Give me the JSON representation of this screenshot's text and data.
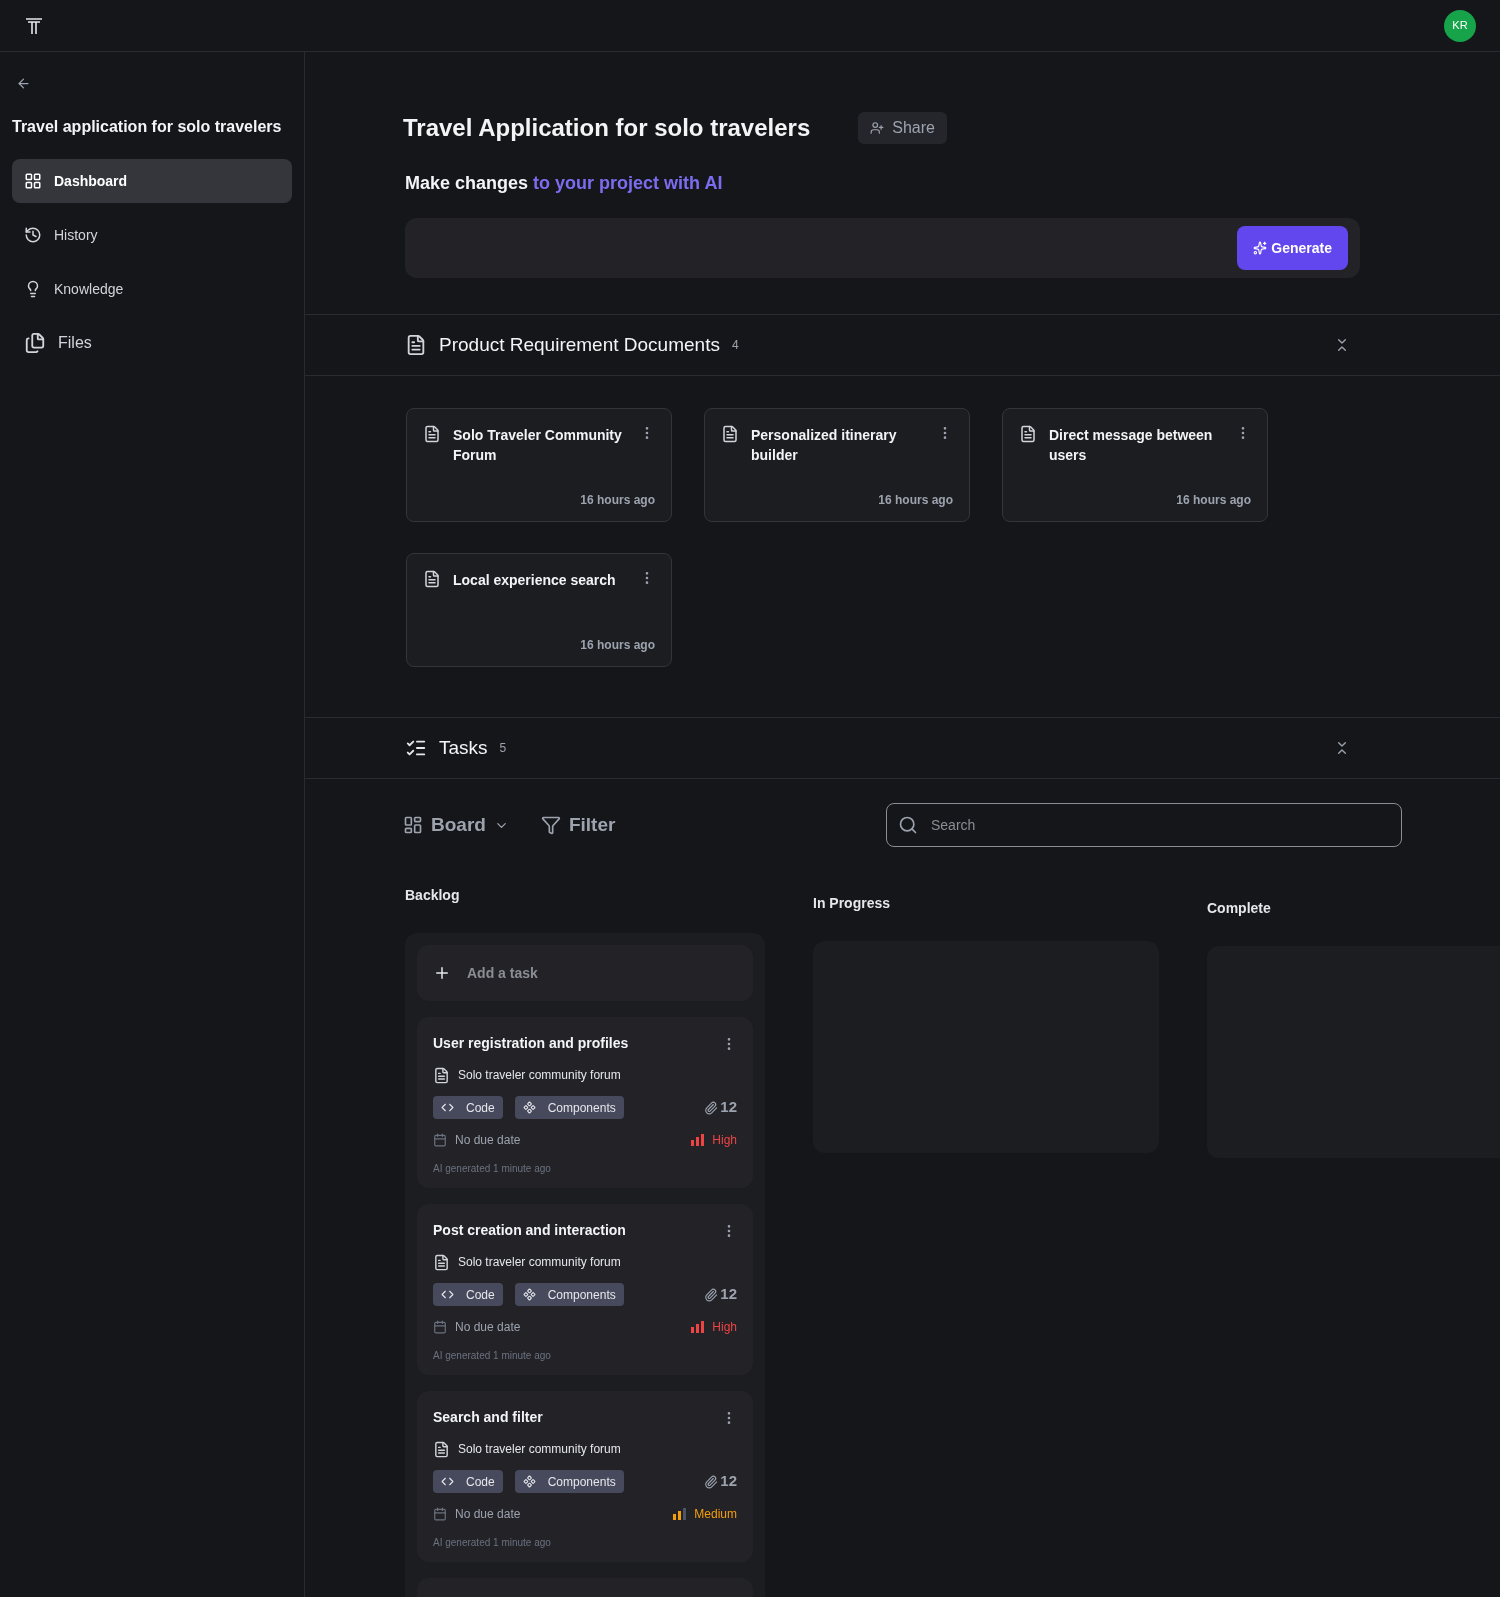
{
  "user": {
    "initials": "KR"
  },
  "sidebar": {
    "title": "Travel application for solo travelers",
    "items": [
      {
        "label": "Dashboard",
        "kind": "grid",
        "selected": true
      },
      {
        "label": "History",
        "kind": "history",
        "selected": false
      },
      {
        "label": "Knowledge",
        "kind": "bulb",
        "selected": false
      },
      {
        "label": "Files",
        "kind": "files",
        "selected": false
      }
    ]
  },
  "project": {
    "title": "Travel Application for solo travelers",
    "share": "Share"
  },
  "ai": {
    "lead": "Make changes",
    "highlight": "to your project with AI",
    "button": "Generate"
  },
  "documents": {
    "title": "Product Requirement Documents",
    "count": "4",
    "items": [
      {
        "title": "Solo Traveler Community Forum",
        "time": "16 hours ago"
      },
      {
        "title": "Personalized itinerary builder",
        "time": "16 hours ago"
      },
      {
        "title": "Direct message between users",
        "time": "16 hours ago"
      },
      {
        "title": "Local experience search",
        "time": "16 hours ago"
      }
    ]
  },
  "tasks": {
    "title": "Tasks",
    "count": "5",
    "view": "Board",
    "filter": "Filter",
    "search": {
      "placeholder": "Search"
    },
    "columns": [
      {
        "title": "Backlog",
        "add": "Add a task",
        "cards": [
          {
            "title": "User registration and profiles",
            "document": "Solo traveler community forum",
            "tags": [
              {
                "label": "Code",
                "kind": "code"
              },
              {
                "label": "Components",
                "kind": "components"
              }
            ],
            "attachments": "12",
            "due": "No due date",
            "priority": {
              "label": "High",
              "kind": "high"
            },
            "note": "AI generated 1 minute ago"
          },
          {
            "title": "Post creation and interaction",
            "document": "Solo traveler community forum",
            "tags": [
              {
                "label": "Code",
                "kind": "code"
              },
              {
                "label": "Components",
                "kind": "components"
              }
            ],
            "attachments": "12",
            "due": "No due date",
            "priority": {
              "label": "High",
              "kind": "high"
            },
            "note": "AI generated 1 minute ago"
          },
          {
            "title": "Search and filter",
            "document": "Solo traveler community forum",
            "tags": [
              {
                "label": "Code",
                "kind": "code"
              },
              {
                "label": "Components",
                "kind": "components"
              }
            ],
            "attachments": "12",
            "due": "No due date",
            "priority": {
              "label": "Medium",
              "kind": "medium"
            },
            "note": "AI generated 1 minute ago"
          }
        ]
      },
      {
        "title": "In Progress"
      },
      {
        "title": "Complete"
      }
    ]
  }
}
